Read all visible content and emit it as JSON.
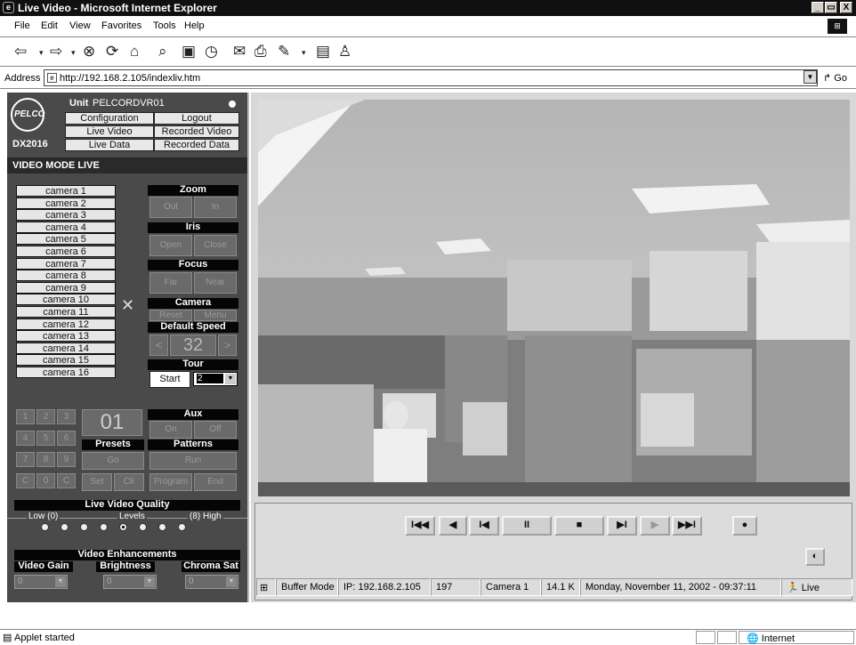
{
  "window": {
    "title": "Live Video - Microsoft Internet Explorer",
    "buttons": [
      "_",
      "Š",
      "X"
    ]
  },
  "menu": [
    "File",
    "Edit",
    "View",
    "Favorites",
    "Tools",
    "Help"
  ],
  "address": {
    "label": "Address",
    "url": "http://192.168.2.105/indexliv.htm",
    "go": "Go"
  },
  "unit": {
    "label": "Unit",
    "name": "PELCORDVR01",
    "logo": "PELCO",
    "model": "DX2016"
  },
  "nav": {
    "configuration": "Configuration",
    "logout": "Logout",
    "live_video": "Live Video",
    "recorded_video": "Recorded Video",
    "live_data": "Live Data",
    "recorded_data": "Recorded Data"
  },
  "mode": "VIDEO MODE LIVE",
  "cameras": [
    "camera 1",
    "camera 2",
    "camera 3",
    "camera 4",
    "camera 5",
    "camera 6",
    "camera 7",
    "camera 8",
    "camera 9",
    "camera 10",
    "camera 11",
    "camera 12",
    "camera 13",
    "camera 14",
    "camera 15",
    "camera 16"
  ],
  "ptz": {
    "zoom": "Zoom",
    "zoom_out": "Out",
    "zoom_in": "In",
    "iris": "Iris",
    "iris_open": "Open",
    "iris_close": "Close",
    "focus": "Focus",
    "focus_far": "Far",
    "focus_near": "Near",
    "camera": "Camera",
    "reset": "Reset",
    "menu": "Menu",
    "speed_label": "Default Speed",
    "speed_dec": "<",
    "speed_value": "32",
    "speed_inc": ">",
    "tour": "Tour",
    "tour_start": "Start",
    "tour_value": "2"
  },
  "keypad": [
    "1",
    "2",
    "3",
    "4",
    "5",
    "6",
    "7",
    "8",
    "9",
    "C",
    "0",
    "C"
  ],
  "preset_display": "01",
  "presets": {
    "label": "Presets",
    "go": "Go",
    "set": "Set",
    "clr": "Clr"
  },
  "aux": {
    "label": "Aux",
    "on": "On",
    "off": "Off"
  },
  "patterns": {
    "label": "Patterns",
    "run": "Run",
    "program": "Program",
    "end": "End"
  },
  "quality": {
    "title": "Live Video Quality",
    "low": "Low (0)",
    "levels": "Levels",
    "high": "(8) High",
    "selected_level": 4,
    "level_count": 8
  },
  "enhancements": {
    "title": "Video Enhancements",
    "gain": "Video Gain",
    "brightness": "Brightness",
    "chroma": "Chroma Sat",
    "gain_value": "0",
    "brightness_value": "0",
    "chroma_value": "0"
  },
  "playback": {
    "first": "I◀◀",
    "back": "◀",
    "step_back": "I◀",
    "pause": "II",
    "stop": "■",
    "step_fwd": "▶I",
    "play": "▶",
    "last": "▶▶I"
  },
  "status": {
    "mode": "Buffer Mode",
    "ip": "IP: 192.168.2.105",
    "frames": "197",
    "camera": "Camera 1",
    "size": "14.1 K",
    "datetime": "Monday, November 11, 2002 - 09:37:11",
    "live": "Live"
  },
  "statusbar": {
    "left": "Applet started",
    "zone": "Internet"
  }
}
